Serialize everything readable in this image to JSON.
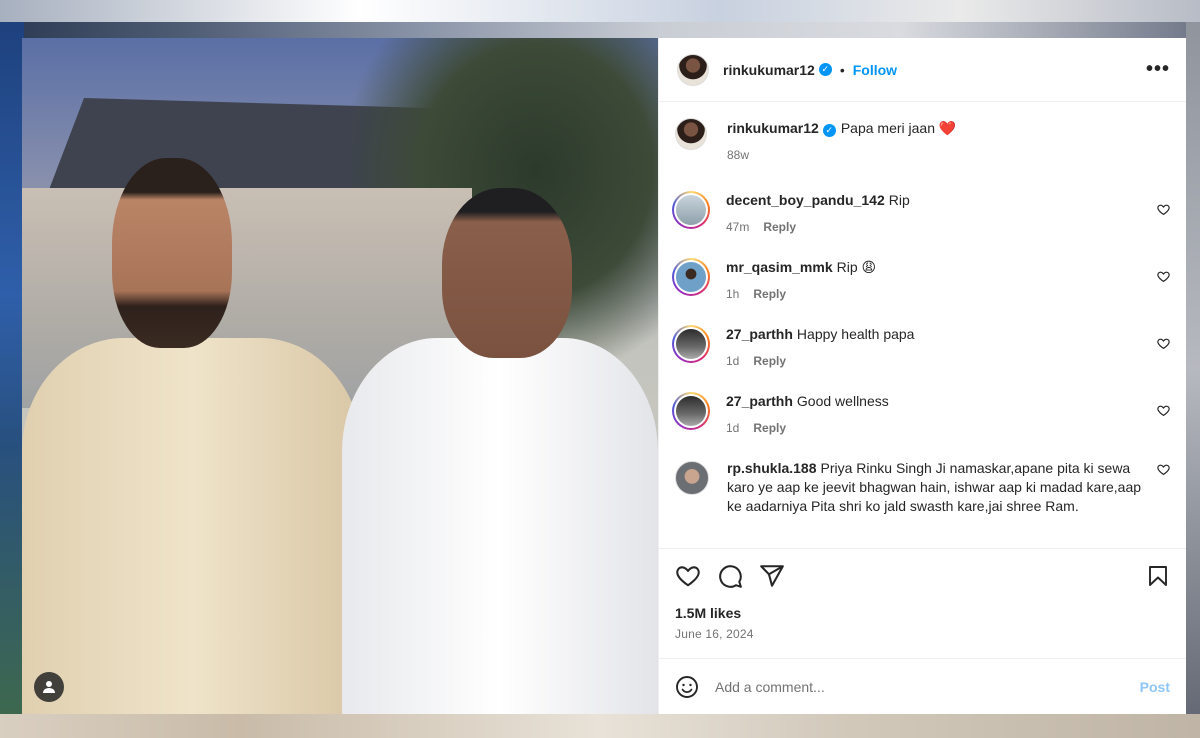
{
  "post": {
    "author": "rinkukumar12",
    "follow_label": "Follow",
    "separator": "•",
    "more_label": "•••",
    "caption_text": "Papa meri jaan",
    "caption_emoji": "❤️",
    "caption_time": "88w"
  },
  "comments": [
    {
      "user": "decent_boy_pandu_142",
      "text": "Rip",
      "time": "47m",
      "reply": "Reply"
    },
    {
      "user": "mr_qasim_mmk",
      "text": "Rip 😩",
      "time": "1h",
      "reply": "Reply"
    },
    {
      "user": "27_parthh",
      "text": "Happy health papa",
      "time": "1d",
      "reply": "Reply"
    },
    {
      "user": "27_parthh",
      "text": "Good wellness",
      "time": "1d",
      "reply": "Reply"
    },
    {
      "user": "rp.shukla.188",
      "text": "Priya Rinku Singh Ji namaskar,apane pita ki sewa karo ye aap ke jeevit bhagwan hain, ishwar aap ki madad kare,aap ke aadarniya Pita shri ko jald swasth kare,jai shree Ram."
    }
  ],
  "stats": {
    "likes": "1.5M likes",
    "date": "June 16, 2024"
  },
  "composer": {
    "placeholder": "Add a comment...",
    "post_label": "Post"
  },
  "colors": {
    "accent": "#0095f6",
    "post_disabled": "#8ec7f7",
    "caption_heart": "#ed4956"
  }
}
